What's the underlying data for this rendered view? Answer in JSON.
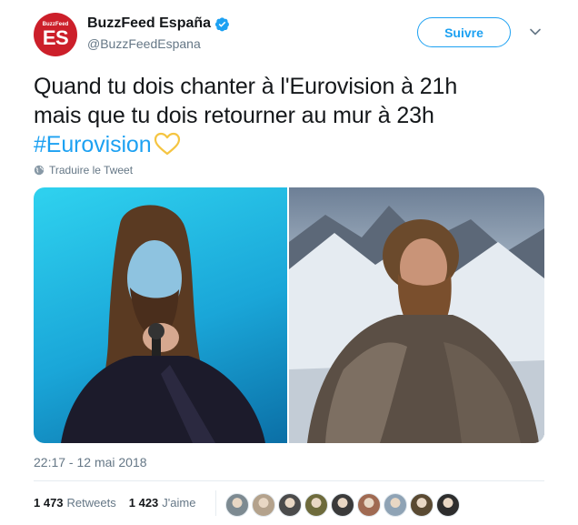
{
  "account": {
    "avatar_small_text": "BuzzFeed",
    "avatar_big_text": "ES",
    "name": "BuzzFeed España",
    "handle": "@BuzzFeedEspana",
    "verified": true
  },
  "actions": {
    "follow_label": "Suivre",
    "menu_icon": "chevron-down-icon"
  },
  "tweet": {
    "line1": "Quand tu dois chanter à l'Eurovision à 21h",
    "line2": "mais que tu dois retourner au mur à 23h",
    "hashtag": "#Eurovision",
    "emoji": "yellow-heart",
    "translate_label": "Traduire le Tweet",
    "timestamp": "22:17 - 12 mai 2018"
  },
  "stats": {
    "retweets_count": "1 473",
    "retweets_label": "Retweets",
    "likes_count": "1 423",
    "likes_label": "J'aime"
  },
  "likers": [
    {
      "color": "#7d8a91"
    },
    {
      "color": "#b4a28c"
    },
    {
      "color": "#4b4b4b"
    },
    {
      "color": "#6e6b3c"
    },
    {
      "color": "#3a3a3a"
    },
    {
      "color": "#a06a52"
    },
    {
      "color": "#8fa3b5"
    },
    {
      "color": "#5a4a32"
    },
    {
      "color": "#2d2d2d"
    }
  ],
  "colors": {
    "brand": "#1da1f2",
    "avatar_bg": "#cc1f2a",
    "muted": "#657786"
  }
}
